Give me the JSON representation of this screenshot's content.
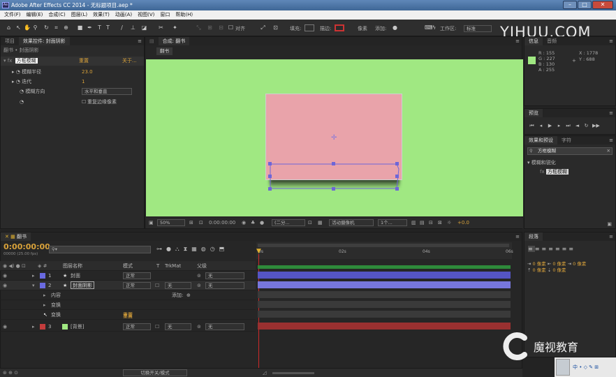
{
  "window": {
    "title": "Adobe After Effects CC 2014 - 无标题项目.aep *",
    "logo": "Ae"
  },
  "menu": [
    "文件(F)",
    "编辑(E)",
    "合成(C)",
    "图层(L)",
    "效果(T)",
    "动画(A)",
    "视图(V)",
    "窗口",
    "帮助(H)"
  ],
  "toolbar": {
    "align_label": "对齐",
    "fill_label": "填充:",
    "stroke_label": "描边:",
    "stroke_px": "像素",
    "add_label": "添加:",
    "workspace_label": "工作区:",
    "workspace_value": "标准",
    "fill_color": "#111111",
    "stroke_color": "#cc3333"
  },
  "watermark": {
    "site": "YIHUU.COM",
    "brand": "魔视教育"
  },
  "project_panel": {
    "tabs": [
      "项目",
      "效果控件: 封面阴影"
    ],
    "breadcrumb": "翻书 • 封面阴影",
    "effect": {
      "name": "方框模糊",
      "reset": "重置",
      "about": "关于..."
    },
    "props": [
      {
        "label": "模糊半径",
        "value": "23.0"
      },
      {
        "label": "迭代",
        "value": "1"
      },
      {
        "label": "模糊方向",
        "value": "水平和垂直"
      },
      {
        "label": "",
        "value": "重复边缘像素"
      }
    ]
  },
  "comp_panel": {
    "tab": "合成: 翻书",
    "subtab": "翻书",
    "footer": {
      "zoom": "50%",
      "timecode": "0:00:00:00",
      "resolution": "(二分...",
      "camera": "活动摄像机",
      "views": "1个...",
      "exposure": "+0.0"
    }
  },
  "info_panel": {
    "tabs": [
      "信息",
      "音频"
    ],
    "swatch": "#a0e882",
    "r": "R : 155",
    "g": "G : 227",
    "b": "B : 130",
    "a": "A : 255",
    "x": "X : 1778",
    "y": "Y : 688"
  },
  "preview_panel": {
    "tab": "预览"
  },
  "effects_panel": {
    "tabs": [
      "效果和预设",
      "字符"
    ],
    "search_value": "方框模糊",
    "category": "模糊和锐化",
    "result": "方框模糊"
  },
  "timeline": {
    "tab": "翻书",
    "timecode": "0:00:00:00",
    "fps": "00000 (25.00 fps)",
    "columns": {
      "name": "图层名称",
      "mode": "模式",
      "trkmat": "TrkMat",
      "parent": "父级"
    },
    "ruler": [
      "0s",
      "02s",
      "04s",
      "06s"
    ],
    "layers": [
      {
        "num": "1",
        "name": "封面",
        "mode": "正常",
        "trk": "",
        "parent": "无",
        "color": "#6a6ae0"
      },
      {
        "num": "2",
        "name": "封面阴影",
        "mode": "正常",
        "trk": "无",
        "parent": "无",
        "color": "#6a6ae0"
      },
      {
        "num": "3",
        "name": "[背景]",
        "mode": "正常",
        "trk": "无",
        "parent": "无",
        "color": "#c33c3c"
      }
    ],
    "sub_rows": [
      "内容",
      "变换",
      "变换"
    ],
    "add_label": "添加:",
    "reset_label": "重置",
    "reset_label2": "重置",
    "footer_toggle": "切换开关/模式"
  },
  "paragraph_panel": {
    "tab": "段落",
    "px_labels": [
      "0 像素",
      "0 像素",
      "0 像素",
      "0 像素",
      "0 像素"
    ]
  },
  "taskbar": {
    "ime": "中",
    "text": "中 • ◇ ✎ ⊞"
  }
}
